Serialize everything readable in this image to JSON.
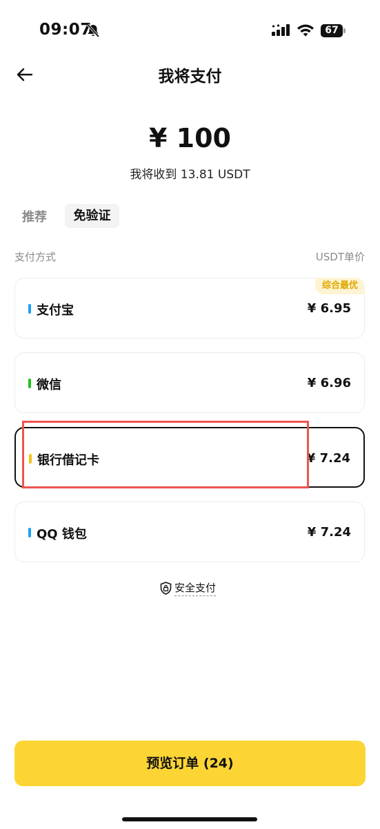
{
  "status_bar": {
    "time": "09:07",
    "battery": "67"
  },
  "header": {
    "title": "我将支付"
  },
  "amount": {
    "value": "¥ 100",
    "receive": "我将收到 13.81 USDT"
  },
  "tabs": [
    {
      "label": "推荐",
      "active": false
    },
    {
      "label": "免验证",
      "active": true
    }
  ],
  "columns": {
    "method": "支付方式",
    "price": "USDT单价"
  },
  "payment_methods": [
    {
      "name": "支付宝",
      "price": "¥ 6.95",
      "badge": "综合最优",
      "color": "#1aa0f5",
      "selected": false
    },
    {
      "name": "微信",
      "price": "¥ 6.96",
      "color": "#1fc21f",
      "selected": false
    },
    {
      "name": "银行借记卡",
      "price": "¥ 7.24",
      "color": "#f0c419",
      "selected": true
    },
    {
      "name": "QQ 钱包",
      "price": "¥ 7.24",
      "color": "#1aa0f5",
      "selected": false
    }
  ],
  "secure": {
    "label": "安全支付"
  },
  "cta": {
    "label": "预览订单 (24)"
  }
}
